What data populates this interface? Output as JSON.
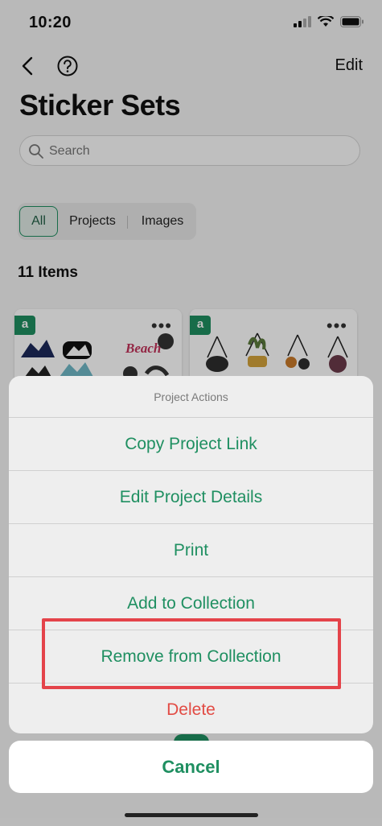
{
  "status_bar": {
    "time": "10:20"
  },
  "nav": {
    "edit_label": "Edit"
  },
  "page": {
    "title": "Sticker Sets"
  },
  "search": {
    "placeholder": "Search"
  },
  "filters": {
    "all": "All",
    "projects": "Projects",
    "images": "Images"
  },
  "items_count": "11 Items",
  "cards": [
    {
      "badge": "a",
      "menu": "•••",
      "label_text": "Beach"
    },
    {
      "badge": "a",
      "menu": "•••"
    }
  ],
  "action_sheet": {
    "title": "Project Actions",
    "actions": [
      {
        "label": "Copy Project Link"
      },
      {
        "label": "Edit Project Details"
      },
      {
        "label": "Print"
      },
      {
        "label": "Add to Collection"
      },
      {
        "label": "Remove from Collection"
      },
      {
        "label": "Delete"
      }
    ],
    "cancel_label": "Cancel"
  },
  "colors": {
    "accent": "#1f8f61",
    "destructive": "#e24b44",
    "highlight": "#e4434a"
  }
}
